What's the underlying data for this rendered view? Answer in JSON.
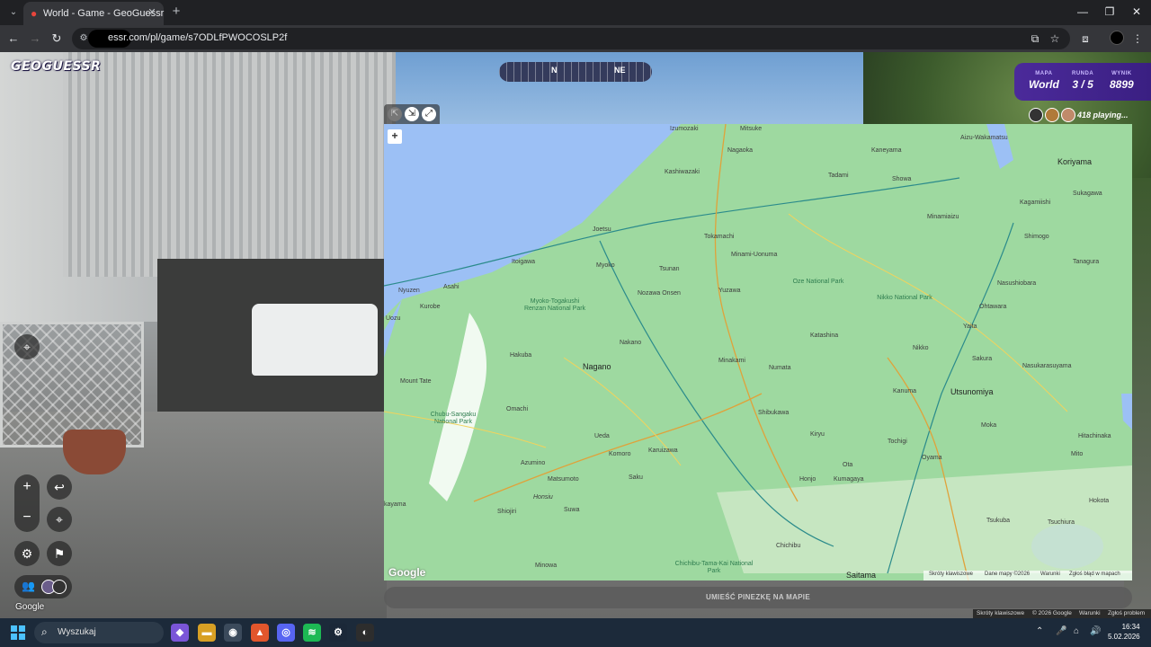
{
  "browser": {
    "tab_title": "World - Game - GeoGuessr",
    "url": "essr.com/pl/game/s7ODLfPWOCOSLP2f",
    "tab_menu_icon": "chevron-down-icon",
    "new_tab": "+"
  },
  "game": {
    "logo": "GEOGUESSR",
    "compass": {
      "n": "N",
      "ne": "NE"
    },
    "status": {
      "map_label": "MAPA",
      "map_value": "World",
      "round_label": "RUNDA",
      "round_value": "3 / 5",
      "score_label": "WYNIK",
      "score_value": "8899"
    },
    "players_text": "418 playing...",
    "guess_button": "UMIEŚĆ PINEZKĘ NA MAPIE",
    "map": {
      "labels": {
        "izumozaki": "Izumozaki",
        "mitsuke": "Mitsuke",
        "nagaoka": "Nagaoka",
        "kashiwazaki": "Kashiwazaki",
        "kaneyama": "Kaneyama",
        "aizu": "Aizu-Wakamatsu",
        "koriyama": "Koriyama",
        "tadami": "Tadami",
        "showa": "Showa",
        "sukagawa": "Sukagawa",
        "kagamiishi": "Kagamiishi",
        "joetsu": "Joetsu",
        "tokamachi": "Tokamachi",
        "minamiaizu": "Minamiaizu",
        "shimogo": "Shimogo",
        "tanagura": "Tanagura",
        "itoigawa": "Itoigawa",
        "myoko": "Myoko",
        "minamiuonuma": "Minami-Uonuma",
        "tsunan": "Tsunan",
        "nasushiobara": "Nasushiobara",
        "ohtawara": "Ohtawara",
        "nyuzen": "Nyuzen",
        "asahi": "Asahi",
        "kurobe": "Kurobe",
        "uozu": "Uozu",
        "myokopark": "Myoko-Togakushi Renzan National Park",
        "nozawa": "Nozawa Onsen",
        "yuzawa": "Yuzawa",
        "oze": "Oze National Park",
        "nikko_np": "Nikko National Park",
        "yaita": "Yaita",
        "nakano": "Nakano",
        "katashina": "Katashina",
        "nikko": "Nikko",
        "sakura": "Sakura",
        "nasukarasuyama": "Nasukarasuyama",
        "hakuba": "Hakuba",
        "nagano": "Nagano",
        "minakami": "Minakami",
        "numata": "Numata",
        "mounttate": "Mount Tate",
        "kanuma": "Kanuma",
        "utsunomiya": "Utsunomiya",
        "omachi": "Omachi",
        "chubu": "Chubu-Sangaku National Park",
        "shibukawa": "Shibukawa",
        "ueda": "Ueda",
        "kiryu": "Kiryu",
        "moka": "Moka",
        "komoro": "Komoro",
        "karuizawa": "Karuizawa",
        "tochigi": "Tochigi",
        "oyama": "Oyama",
        "hitachinaka": "Hitachinaka",
        "azumino": "Azumino",
        "matsumoto": "Matsumoto",
        "saku": "Saku",
        "honjo": "Honjo",
        "ota": "Ota",
        "mito": "Mito",
        "honsiu": "Honsiu",
        "kumagaya": "Kumagaya",
        "hokota": "Hokota",
        "shiojiri": "Shiojiri",
        "suwa": "Suwa",
        "tsukuba": "Tsukuba",
        "tsuchiura": "Tsuchiura",
        "chichibu": "Chichibu",
        "chichibupark": "Chichibu-Tama-Kai National Park",
        "minowa": "Minowa",
        "saitama": "Saitama",
        "kayama": "kayama"
      },
      "google": "Google",
      "footer": {
        "shortcuts": "Skróty klawiszowe",
        "data": "Dane mapy ©2026",
        "terms": "Warunki",
        "report": "Zgłoś błąd w mapach"
      },
      "zoom_in": "+"
    },
    "streetview_google": "Google",
    "sv_footer": {
      "shortcuts": "Skróty klawiszowe",
      "copy": "© 2026 Google",
      "terms": "Warunki",
      "report": "Zgłoś problem"
    }
  },
  "taskbar": {
    "search_placeholder": "Wyszukaj",
    "time": "16:34",
    "date": "5.02.2026"
  }
}
